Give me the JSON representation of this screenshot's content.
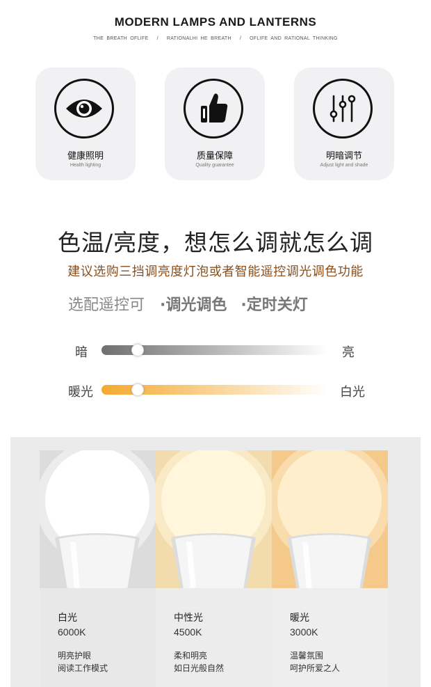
{
  "header": {
    "title": "MODERN LAMPS AND LANTERNS",
    "tagline": [
      "THE BREATH OFLIFE",
      "RATIONALHI HE BREATH",
      "OFLIFE AND RATIONAL THINKING"
    ],
    "separator": "/"
  },
  "features": [
    {
      "icon": "eye-icon",
      "title": "健康照明",
      "subtitle": "Health lighting"
    },
    {
      "icon": "thumbs-up-icon",
      "title": "质量保障",
      "subtitle": "Quality guarantee"
    },
    {
      "icon": "sliders-icon",
      "title": "明暗调节",
      "subtitle": "Adjust light and shade"
    }
  ],
  "promo": {
    "headline": "色温/亮度，想怎么调就怎么调",
    "subline": "建议选购三挡调亮度灯泡或者智能遥控调光调色功能",
    "options": [
      "选配遥控可",
      "·调光调色",
      "·定时关灯"
    ]
  },
  "sliders": [
    {
      "left_label": "暗",
      "right_label": "亮",
      "level": 0.16,
      "start_color": "#6f6f6f",
      "end_color": "#ffffff"
    },
    {
      "left_label": "暖光",
      "right_label": "白光",
      "level": 0.16,
      "start_color": "#f4a930",
      "end_color": "#ffffff"
    }
  ],
  "bulbs": [
    {
      "name": "白光",
      "temperature": "6000K",
      "desc_line1": "明亮护眼",
      "desc_line2": "阅读工作模式",
      "glow": "#ffffff",
      "bg": "#dcdcdc"
    },
    {
      "name": "中性光",
      "temperature": "4500K",
      "desc_line1": "柔和明亮",
      "desc_line2": "如日光般自然",
      "glow": "#fff6dc",
      "bg": "#f2dcae"
    },
    {
      "name": "暖光",
      "temperature": "3000K",
      "desc_line1": "温馨氛围",
      "desc_line2": "呵护所爱之人",
      "glow": "#ffeecb",
      "bg": "#f5c98a"
    }
  ]
}
